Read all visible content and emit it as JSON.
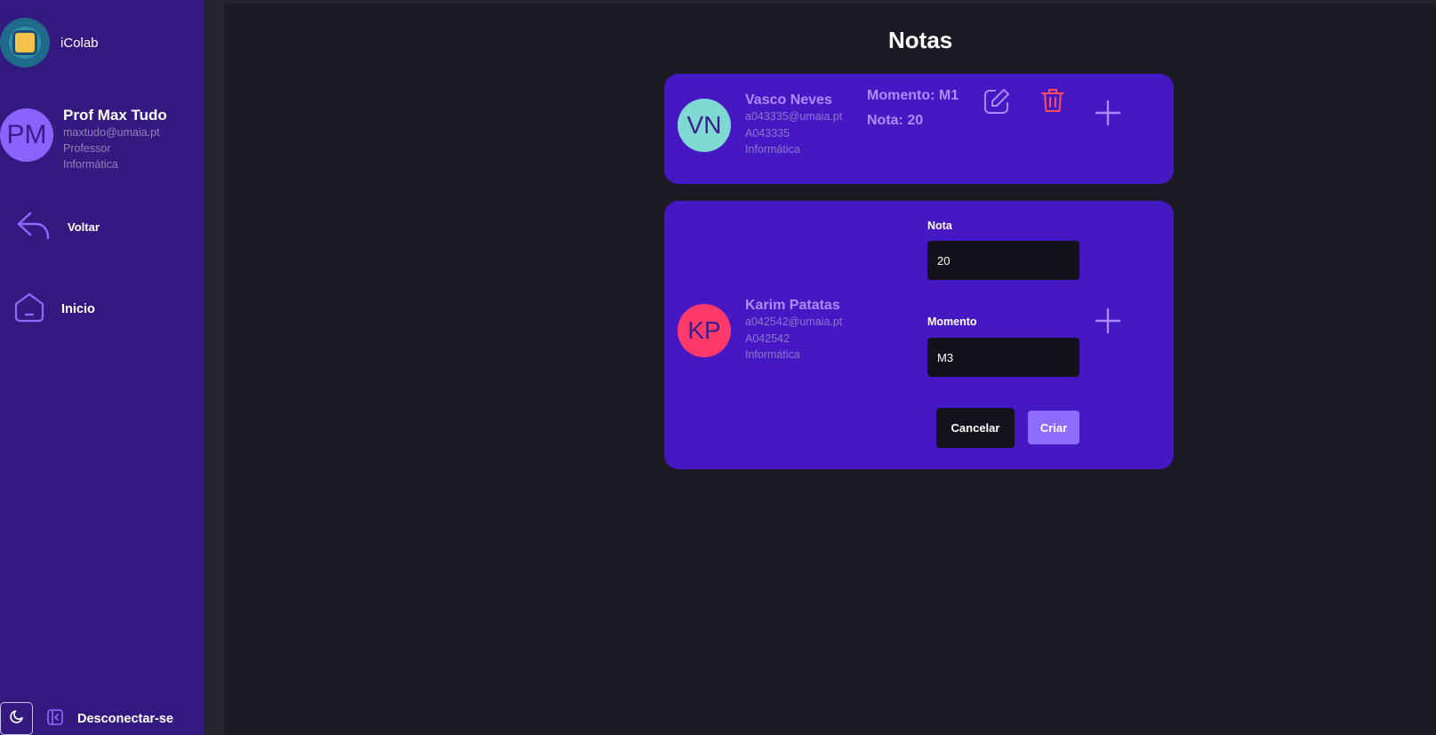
{
  "app": {
    "name": "iColab"
  },
  "user": {
    "initials": "PM",
    "name": "Prof Max Tudo",
    "email": "maxtudo@umaia.pt",
    "role": "Professor",
    "department": "Informática"
  },
  "nav": {
    "back_label": "Voltar",
    "home_label": "Inicio",
    "logout_label": "Desconectar-se"
  },
  "page": {
    "title": "Notas"
  },
  "students": [
    {
      "initials": "VN",
      "name": "Vasco Neves",
      "email": "a043335@umaia.pt",
      "number": "A043335",
      "course": "Informática",
      "avatar_color": "#7fd8d2",
      "grade": {
        "momento_text": "Momento: M1",
        "nota_text": "Nota: 20"
      }
    },
    {
      "initials": "KP",
      "name": "Karim Patatas",
      "email": "a042542@umaia.pt",
      "number": "A042542",
      "course": "Informática",
      "avatar_color": "#ff3a6b"
    }
  ],
  "form": {
    "nota_label": "Nota",
    "nota_value": "20",
    "momento_label": "Momento",
    "momento_value": "M3",
    "cancel_label": "Cancelar",
    "create_label": "Criar"
  },
  "colors": {
    "sidebar_bg": "#341a80",
    "card_bg": "#4518c3",
    "accent": "#8d6cff",
    "delete": "#ff4d5e",
    "page_bg": "#1c1b25"
  }
}
